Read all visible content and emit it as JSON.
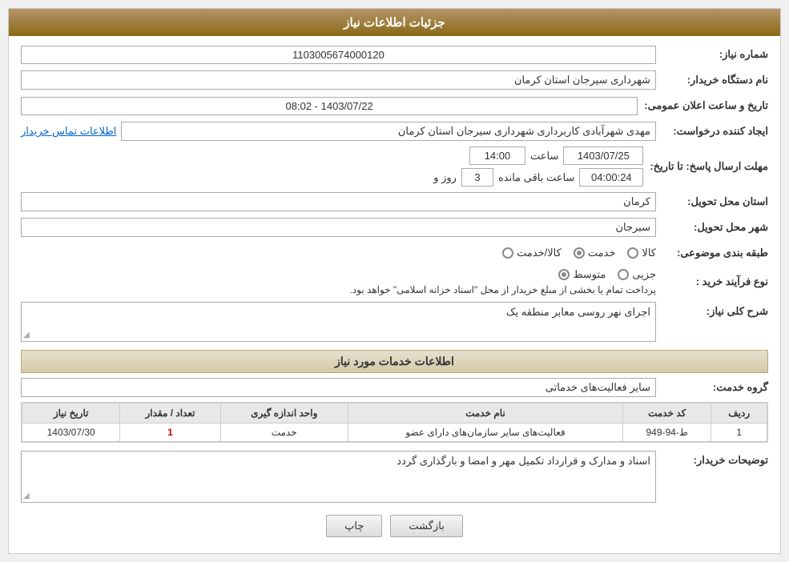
{
  "page": {
    "title": "جزئیات اطلاعات نیاز"
  },
  "fields": {
    "shomareNiaz_label": "شماره نیاز:",
    "shomareNiaz_value": "1103005674000120",
    "namDastgah_label": "نام دستگاه خریدار:",
    "namDastgah_value": "شهرداری سیرجان استان کرمان",
    "tarikho_label": "تاریخ و ساعت اعلان عمومی:",
    "tarikho_value": "1403/07/22 - 08:02",
    "ijadKonande_label": "ایجاد کننده درخواست:",
    "ijadKonande_value": "مهدی شهرآبادی کاربرداری شهرداری سیرجان استان کرمان",
    "atrContact_label": "اطلاعات تماس خریدار",
    "mohlatErsaal_label": "مهلت ارسال پاسخ: تا تاریخ:",
    "mohlatDate_value": "1403/07/25",
    "mohlatSaat_label": "ساعت",
    "mohlatSaat_value": "14:00",
    "mohlatRoz_label": "روز و",
    "mohlatRoz_value": "3",
    "mohlatBaghimande_label": "ساعت باقی مانده",
    "mohlatBaghimande_value": "04:00:24",
    "ostanTahvil_label": "استان محل تحویل:",
    "ostanTahvil_value": "کرمان",
    "shahrTahvil_label": "شهر محل تحویل:",
    "shahrTahvil_value": "سیرجان",
    "tabqebandi_label": "طبقه بندی موضوعی:",
    "tabqebandi_options": [
      "کالا",
      "خدمت",
      "کالا/خدمت"
    ],
    "tabqebandi_selected": "خدمت",
    "noeFarayand_label": "نوع فرآیند خرید :",
    "noeFarayand_options": [
      "جزیی",
      "متوسط"
    ],
    "noeFarayand_selected": "متوسط",
    "noeFarayand_note": "پرداخت تمام یا بخشی از مبلغ خریدار از محل \"اسناد خزانه اسلامی\" خواهد بود.",
    "sharhKolli_label": "شرح کلی نیاز:",
    "sharhKolli_value": "اجرای نهر روسی معابر منطقه یک",
    "services_section_label": "اطلاعات خدمات مورد نیاز",
    "grouhKhadamat_label": "گروه خدمت:",
    "grouhKhadamat_value": "سایر فعالیت‌های خدماتی",
    "table": {
      "headers": [
        "ردیف",
        "کد خدمت",
        "نام خدمت",
        "واحد اندازه گیری",
        "تعداد / مقدار",
        "تاریخ نیاز"
      ],
      "rows": [
        {
          "radif": "1",
          "kod": "ط-94-949",
          "nam": "فعالیت‌های سایر سازمان‌های دارای عضو",
          "vahed": "خدمت",
          "tedad": "1",
          "tarikh": "1403/07/30"
        }
      ]
    },
    "tosihKhridar_label": "توضیحات خریدار:",
    "tosihKhridar_value": "اسناد و مدارک و قرارداد تکمیل مهر و امضا و بارگذاری گردد",
    "btn_back": "بازگشت",
    "btn_print": "چاپ"
  }
}
